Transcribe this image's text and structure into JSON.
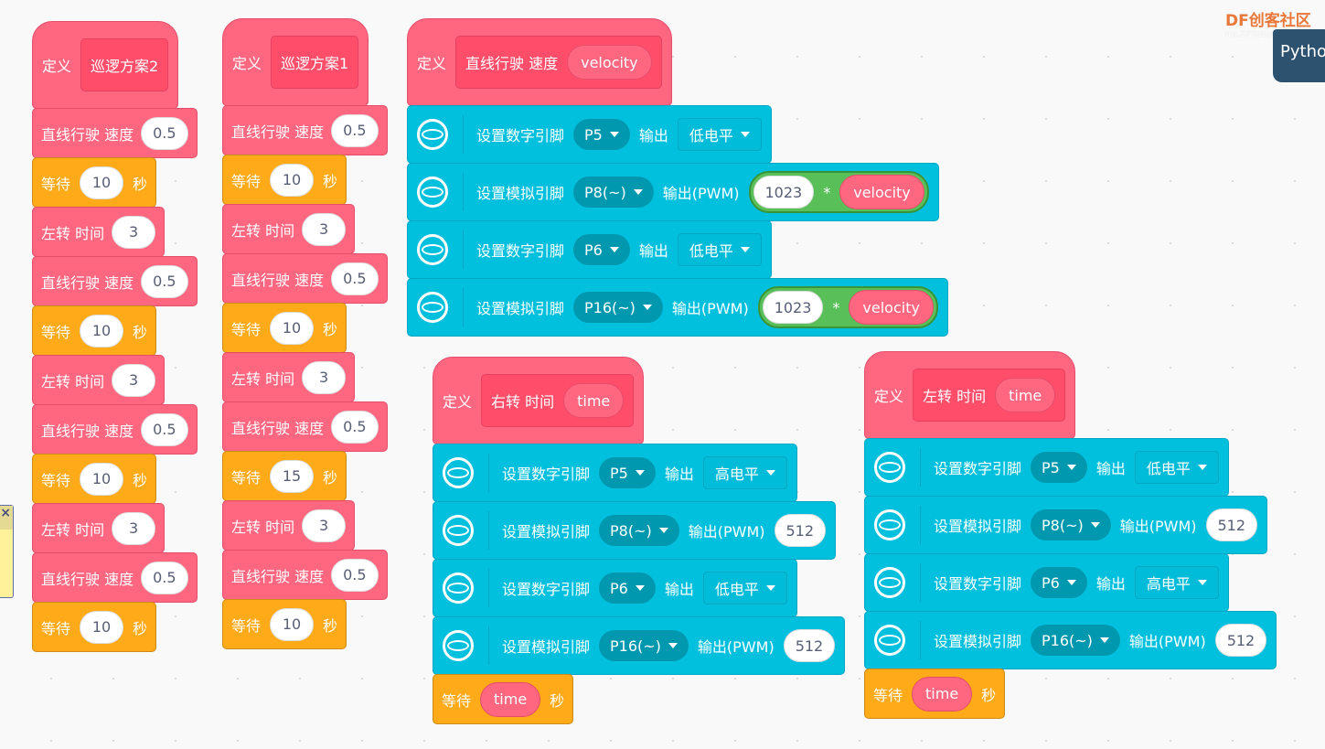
{
  "branding": {
    "logo_text": "DF创客社区",
    "logo_sub": "mc.DFRobot.com.cn",
    "python_tab": "Pytho"
  },
  "note": {
    "close_label": "×"
  },
  "colors": {
    "motion": "#FF6680",
    "wait": "#FFAB19",
    "pin": "#00C0DE",
    "operator": "#59C059"
  },
  "scripts": [
    {
      "define": "定义",
      "name": "巡逻方案2",
      "blocks": [
        {
          "t": "move",
          "label": "直线行驶 速度",
          "value": "0.5"
        },
        {
          "t": "wait",
          "label": "等待",
          "value": "10",
          "unit": "秒"
        },
        {
          "t": "turn",
          "label": "左转 时间",
          "value": "3"
        },
        {
          "t": "move",
          "label": "直线行驶 速度",
          "value": "0.5"
        },
        {
          "t": "wait",
          "label": "等待",
          "value": "10",
          "unit": "秒"
        },
        {
          "t": "turn",
          "label": "左转 时间",
          "value": "3"
        },
        {
          "t": "move",
          "label": "直线行驶 速度",
          "value": "0.5"
        },
        {
          "t": "wait",
          "label": "等待",
          "value": "10",
          "unit": "秒"
        },
        {
          "t": "turn",
          "label": "左转 时间",
          "value": "3"
        },
        {
          "t": "move",
          "label": "直线行驶 速度",
          "value": "0.5"
        },
        {
          "t": "wait",
          "label": "等待",
          "value": "10",
          "unit": "秒"
        }
      ]
    },
    {
      "define": "定义",
      "name": "巡逻方案1",
      "blocks": [
        {
          "t": "move",
          "label": "直线行驶 速度",
          "value": "0.5"
        },
        {
          "t": "wait",
          "label": "等待",
          "value": "10",
          "unit": "秒"
        },
        {
          "t": "turn",
          "label": "左转 时间",
          "value": "3"
        },
        {
          "t": "move",
          "label": "直线行驶 速度",
          "value": "0.5"
        },
        {
          "t": "wait",
          "label": "等待",
          "value": "10",
          "unit": "秒"
        },
        {
          "t": "turn",
          "label": "左转 时间",
          "value": "3"
        },
        {
          "t": "move",
          "label": "直线行驶 速度",
          "value": "0.5"
        },
        {
          "t": "wait",
          "label": "等待",
          "value": "15",
          "unit": "秒"
        },
        {
          "t": "turn",
          "label": "左转 时间",
          "value": "3"
        },
        {
          "t": "move",
          "label": "直线行驶 速度",
          "value": "0.5"
        },
        {
          "t": "wait",
          "label": "等待",
          "value": "10",
          "unit": "秒"
        }
      ]
    },
    {
      "define": "定义",
      "name": "直线行驶 速度",
      "param": "velocity",
      "blocks": [
        {
          "t": "digital",
          "label": "设置数字引脚",
          "pin": "P5",
          "out": "输出",
          "level": "低电平"
        },
        {
          "t": "analog",
          "label": "设置模拟引脚",
          "pin": "P8(~)",
          "out": "输出(PWM)",
          "expr": {
            "a": "1023",
            "op": "*",
            "b": "velocity"
          }
        },
        {
          "t": "digital",
          "label": "设置数字引脚",
          "pin": "P6",
          "out": "输出",
          "level": "低电平"
        },
        {
          "t": "analog",
          "label": "设置模拟引脚",
          "pin": "P16(~)",
          "out": "输出(PWM)",
          "expr": {
            "a": "1023",
            "op": "*",
            "b": "velocity"
          }
        }
      ]
    },
    {
      "define": "定义",
      "name": "右转 时间",
      "param": "time",
      "blocks": [
        {
          "t": "digital",
          "label": "设置数字引脚",
          "pin": "P5",
          "out": "输出",
          "level": "高电平"
        },
        {
          "t": "analog",
          "label": "设置模拟引脚",
          "pin": "P8(~)",
          "out": "输出(PWM)",
          "value": "512"
        },
        {
          "t": "digital",
          "label": "设置数字引脚",
          "pin": "P6",
          "out": "输出",
          "level": "低电平"
        },
        {
          "t": "analog",
          "label": "设置模拟引脚",
          "pin": "P16(~)",
          "out": "输出(PWM)",
          "value": "512"
        },
        {
          "t": "wait",
          "label": "等待",
          "reporter": "time",
          "unit": "秒"
        }
      ]
    },
    {
      "define": "定义",
      "name": "左转 时间",
      "param": "time",
      "blocks": [
        {
          "t": "digital",
          "label": "设置数字引脚",
          "pin": "P5",
          "out": "输出",
          "level": "低电平"
        },
        {
          "t": "analog",
          "label": "设置模拟引脚",
          "pin": "P8(~)",
          "out": "输出(PWM)",
          "value": "512"
        },
        {
          "t": "digital",
          "label": "设置数字引脚",
          "pin": "P6",
          "out": "输出",
          "level": "高电平"
        },
        {
          "t": "analog",
          "label": "设置模拟引脚",
          "pin": "P16(~)",
          "out": "输出(PWM)",
          "value": "512"
        },
        {
          "t": "wait",
          "label": "等待",
          "reporter": "time",
          "unit": "秒"
        }
      ]
    }
  ]
}
